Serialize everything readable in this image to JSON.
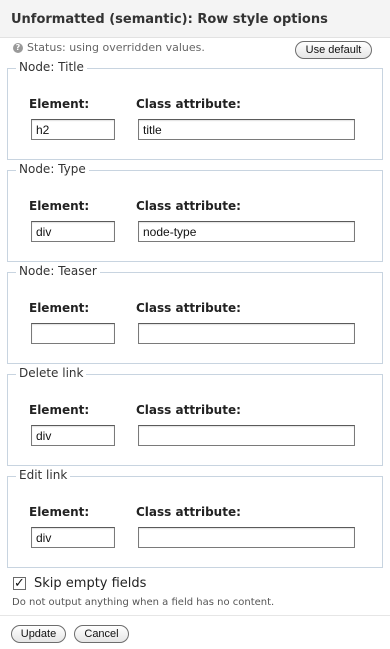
{
  "header": {
    "title": "Unformatted (semantic): Row style options"
  },
  "status": {
    "icon": "help-icon",
    "text": "Status: using overridden values.",
    "use_default_label": "Use default"
  },
  "columns": {
    "element": "Element:",
    "class_attribute": "Class attribute:"
  },
  "nodes": [
    {
      "legend": "Node: Title",
      "element": "h2",
      "class_attribute": "title"
    },
    {
      "legend": "Node: Type",
      "element": "div",
      "class_attribute": "node-type"
    },
    {
      "legend": "Node: Teaser",
      "element": "",
      "class_attribute": ""
    },
    {
      "legend": "Delete link",
      "element": "div",
      "class_attribute": ""
    },
    {
      "legend": "Edit link",
      "element": "div",
      "class_attribute": ""
    }
  ],
  "skip_empty": {
    "checked": true,
    "label": "Skip empty fields",
    "description": "Do not output anything when a field has no content."
  },
  "buttons": {
    "update": "Update",
    "cancel": "Cancel"
  }
}
